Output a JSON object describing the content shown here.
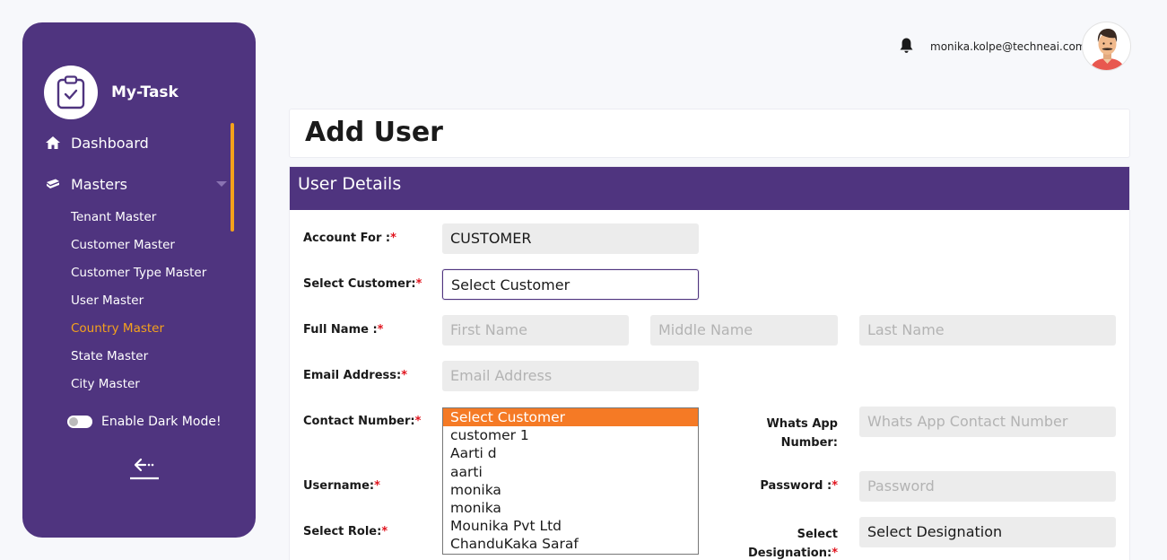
{
  "brand": {
    "name": "My-Task"
  },
  "sidebar": {
    "dashboard": "Dashboard",
    "masters": "Masters",
    "sub_items": [
      {
        "label": "Tenant Master"
      },
      {
        "label": "Customer Master"
      },
      {
        "label": "Customer Type Master"
      },
      {
        "label": "User Master"
      },
      {
        "label": "Country Master"
      },
      {
        "label": "State Master"
      },
      {
        "label": "City Master"
      }
    ],
    "active_item": "Country Master",
    "dark_mode_label": "Enable Dark Mode!"
  },
  "header": {
    "user_email": "monika.kolpe@techneai.com"
  },
  "page": {
    "title": "Add User",
    "section_title": "User Details"
  },
  "form": {
    "account_for": {
      "label": "Account For :",
      "value": "CUSTOMER"
    },
    "select_customer": {
      "label": "Select Customer:",
      "value": "Select Customer"
    },
    "full_name": {
      "label": "Full Name :",
      "first": "First Name",
      "middle": "Middle Name",
      "last": "Last Name"
    },
    "email": {
      "label": "Email Address:",
      "placeholder": "Email Address"
    },
    "contact": {
      "label": "Contact Number:"
    },
    "whatsapp": {
      "label_line1": "Whats App",
      "label_line2": "Number:",
      "placeholder": "Whats App Contact Number"
    },
    "username": {
      "label": "Username:"
    },
    "password": {
      "label": "Password :",
      "placeholder": "Password"
    },
    "role": {
      "label": "Select Role:"
    },
    "designation": {
      "label_line1": "Select",
      "label_line2": "Designation:",
      "value": "Select Designation"
    },
    "required_mark": "*"
  },
  "customer_dropdown": {
    "options": [
      "Select Customer",
      "customer 1",
      "Aarti d",
      "aarti",
      "monika",
      "monika",
      "Mounika Pvt Ltd",
      "ChanduKaka Saraf"
    ],
    "highlighted": "Select Customer"
  },
  "colors": {
    "sidebar_bg": "#4f347f",
    "accent": "#f5a21c",
    "dropdown_highlight": "#f57a25",
    "required": "#e0141e"
  },
  "icons": [
    "clipboard-check-icon",
    "home-icon",
    "ticket-icon",
    "bell-icon",
    "back-arrow-icon"
  ]
}
